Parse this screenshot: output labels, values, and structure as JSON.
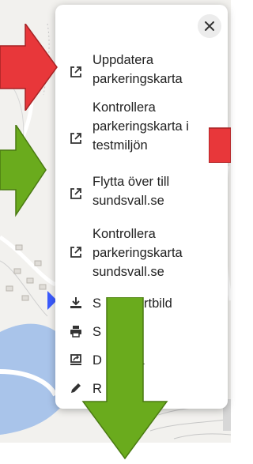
{
  "menu": {
    "close_label": "×",
    "items": [
      {
        "label": "Uppdatera parkeringskarta",
        "icon": "open-external-icon"
      },
      {
        "label": "Kontrollera parkeringskarta i testmiljön",
        "icon": "open-external-icon"
      },
      {
        "label": "Flytta över till sundsvall.se",
        "icon": "open-external-icon"
      },
      {
        "label": "Kontrollera parkeringskarta sundsvall.se",
        "icon": "open-external-icon"
      },
      {
        "label": "S",
        "label_tail": "rtbild",
        "icon": "download-icon"
      },
      {
        "label": "S",
        "icon": "print-icon"
      },
      {
        "label": "D",
        "label_tail": "ta",
        "icon": "screen-share-icon"
      },
      {
        "label": "R",
        "icon": "pencil-icon"
      }
    ]
  },
  "colors": {
    "red_arrow": "#e8373a",
    "green_arrow": "#6aab1d",
    "arrow_outline": "#4a7a12",
    "map_background": "#f2f1ee",
    "water": "#a9c4ea",
    "marker_blue": "#3b5bff"
  }
}
